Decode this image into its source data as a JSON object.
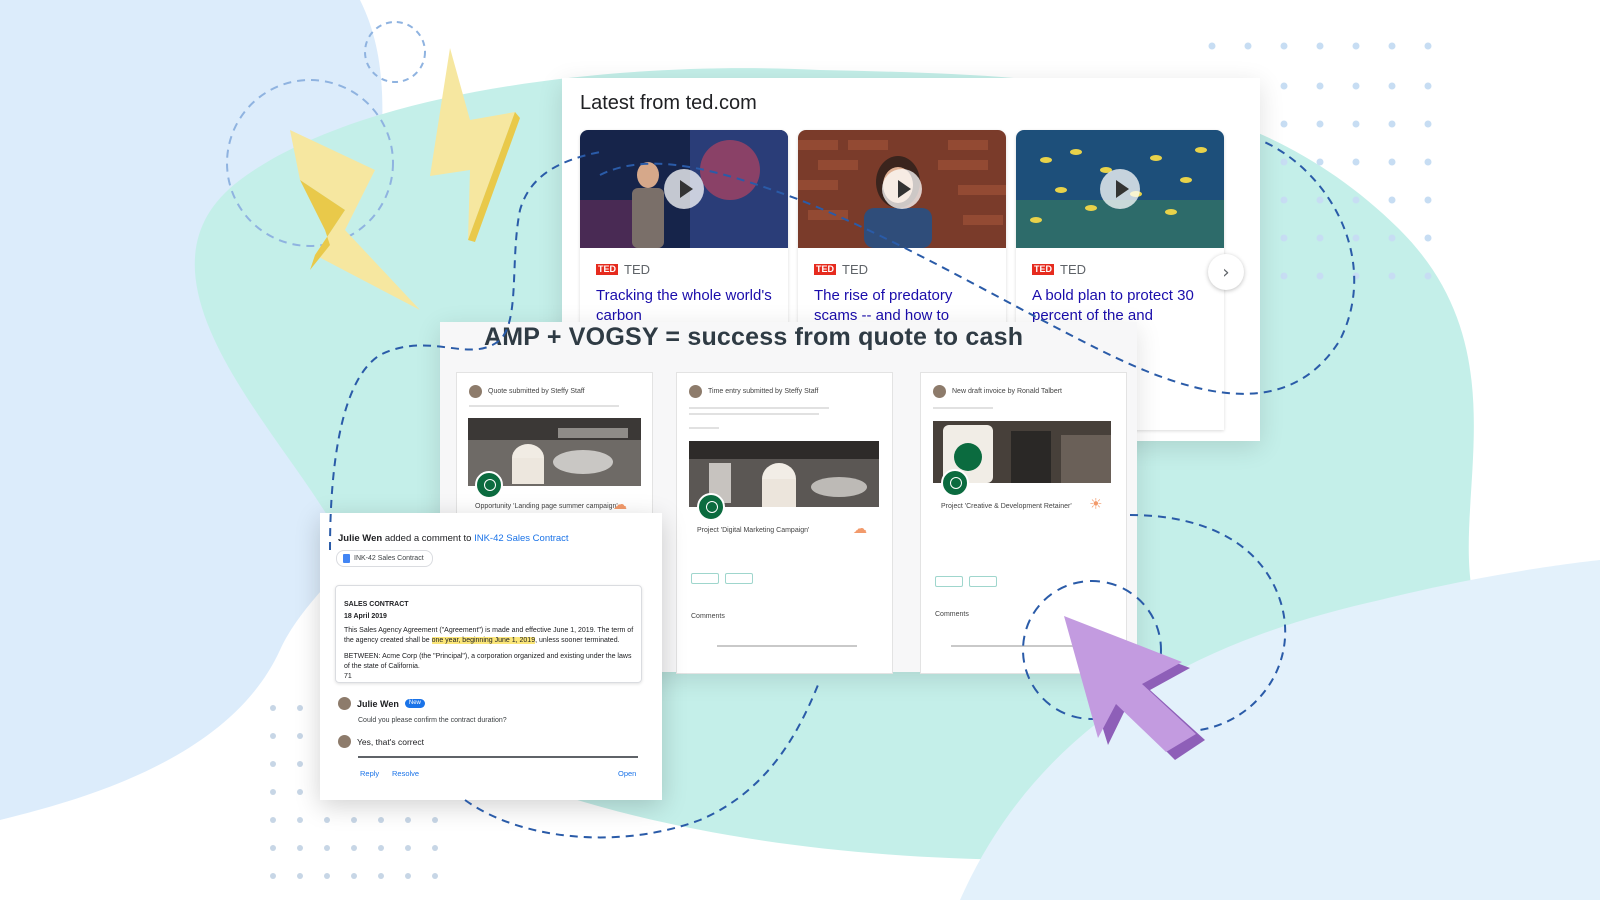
{
  "ted": {
    "heading": "Latest from ted.com",
    "source_label": "TED",
    "logo_text": "TED",
    "cards": [
      {
        "title": "Tracking the whole world's carbon"
      },
      {
        "title": "The rise of predatory scams -- and how to"
      },
      {
        "title": "A bold plan to protect 30 percent of the and"
      }
    ],
    "next_icon": "›"
  },
  "amp": {
    "title": "AMP + VOGSY = success from quote to cash",
    "emails": [
      {
        "header": "Quote submitted by Steffy Staff",
        "project": "Opportunity 'Landing page summer campaign'"
      },
      {
        "header": "Time entry submitted by Steffy Staff",
        "project": "Project 'Digital Marketing Campaign'",
        "comments": "Comments"
      },
      {
        "header": "New draft invoice by Ronald Talbert",
        "project": "Project 'Creative & Development Retainer'",
        "comments": "Comments"
      }
    ]
  },
  "docs": {
    "author": "Julie Wen",
    "action": "added a comment to",
    "doc_link": "INK-42 Sales Contract",
    "chip_label": "INK-42 Sales Contract",
    "contract_title": "SALES CONTRACT",
    "contract_date": "18 April 2019",
    "contract_p1_a": "This Sales Agency Agreement (\"Agreement\") is made and effective June 1, 2019. The term of the agency created shall be ",
    "contract_p1_hl": "one year, beginning June 1, 2019",
    "contract_p1_b": ", unless sooner terminated.",
    "contract_p2": "BETWEEN: Acme Corp (the \"Principal\"), a corporation organized and existing under the laws of the state of California.",
    "contract_p3": "71",
    "commenter": "Julie Wen",
    "new_badge": "New",
    "question": "Could you please confirm the contract duration?",
    "reply_text": "Yes, that's correct",
    "reply_label": "Reply",
    "resolve_label": "Resolve",
    "open_label": "Open"
  },
  "colors": {
    "ted_title": "#1a0dab",
    "ted_red": "#e62b1e",
    "blob_mint": "#bfeee8",
    "blob_blue": "#ddeefa",
    "dash_blue": "#2a5ba8",
    "bolt_yellow": "#f5e07a",
    "cursor_purple": "#b98ad6",
    "link_blue": "#1a73e8"
  }
}
